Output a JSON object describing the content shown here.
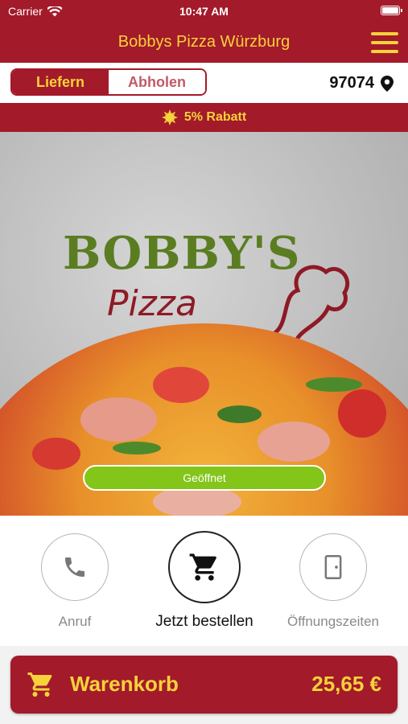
{
  "status_bar": {
    "carrier": "Carrier",
    "time": "10:47 AM"
  },
  "nav": {
    "title": "Bobbys Pizza Würzburg",
    "menu_icon": "hamburger-menu-icon"
  },
  "delivery_mode": {
    "options": [
      "Liefern",
      "Abholen"
    ],
    "selected": "Liefern"
  },
  "location": {
    "postal_code": "97074",
    "icon": "location-pin-icon"
  },
  "discount": {
    "label": "5% Rabatt",
    "icon": "sun-badge-icon"
  },
  "hero": {
    "logo_line1": "BOBBY'S",
    "logo_line2": "Pizza",
    "status": "Geöffnet"
  },
  "actions": [
    {
      "label": "Anruf",
      "icon": "phone-icon"
    },
    {
      "label": "Jetzt bestellen",
      "icon": "cart-icon"
    },
    {
      "label": "Öffnungszeiten",
      "icon": "door-icon"
    }
  ],
  "cart": {
    "label": "Warenkorb",
    "total": "25,65 €",
    "icon": "cart-icon"
  },
  "colors": {
    "brand": "#a31a2a",
    "accent": "#f6d23b",
    "open": "#83c519"
  }
}
